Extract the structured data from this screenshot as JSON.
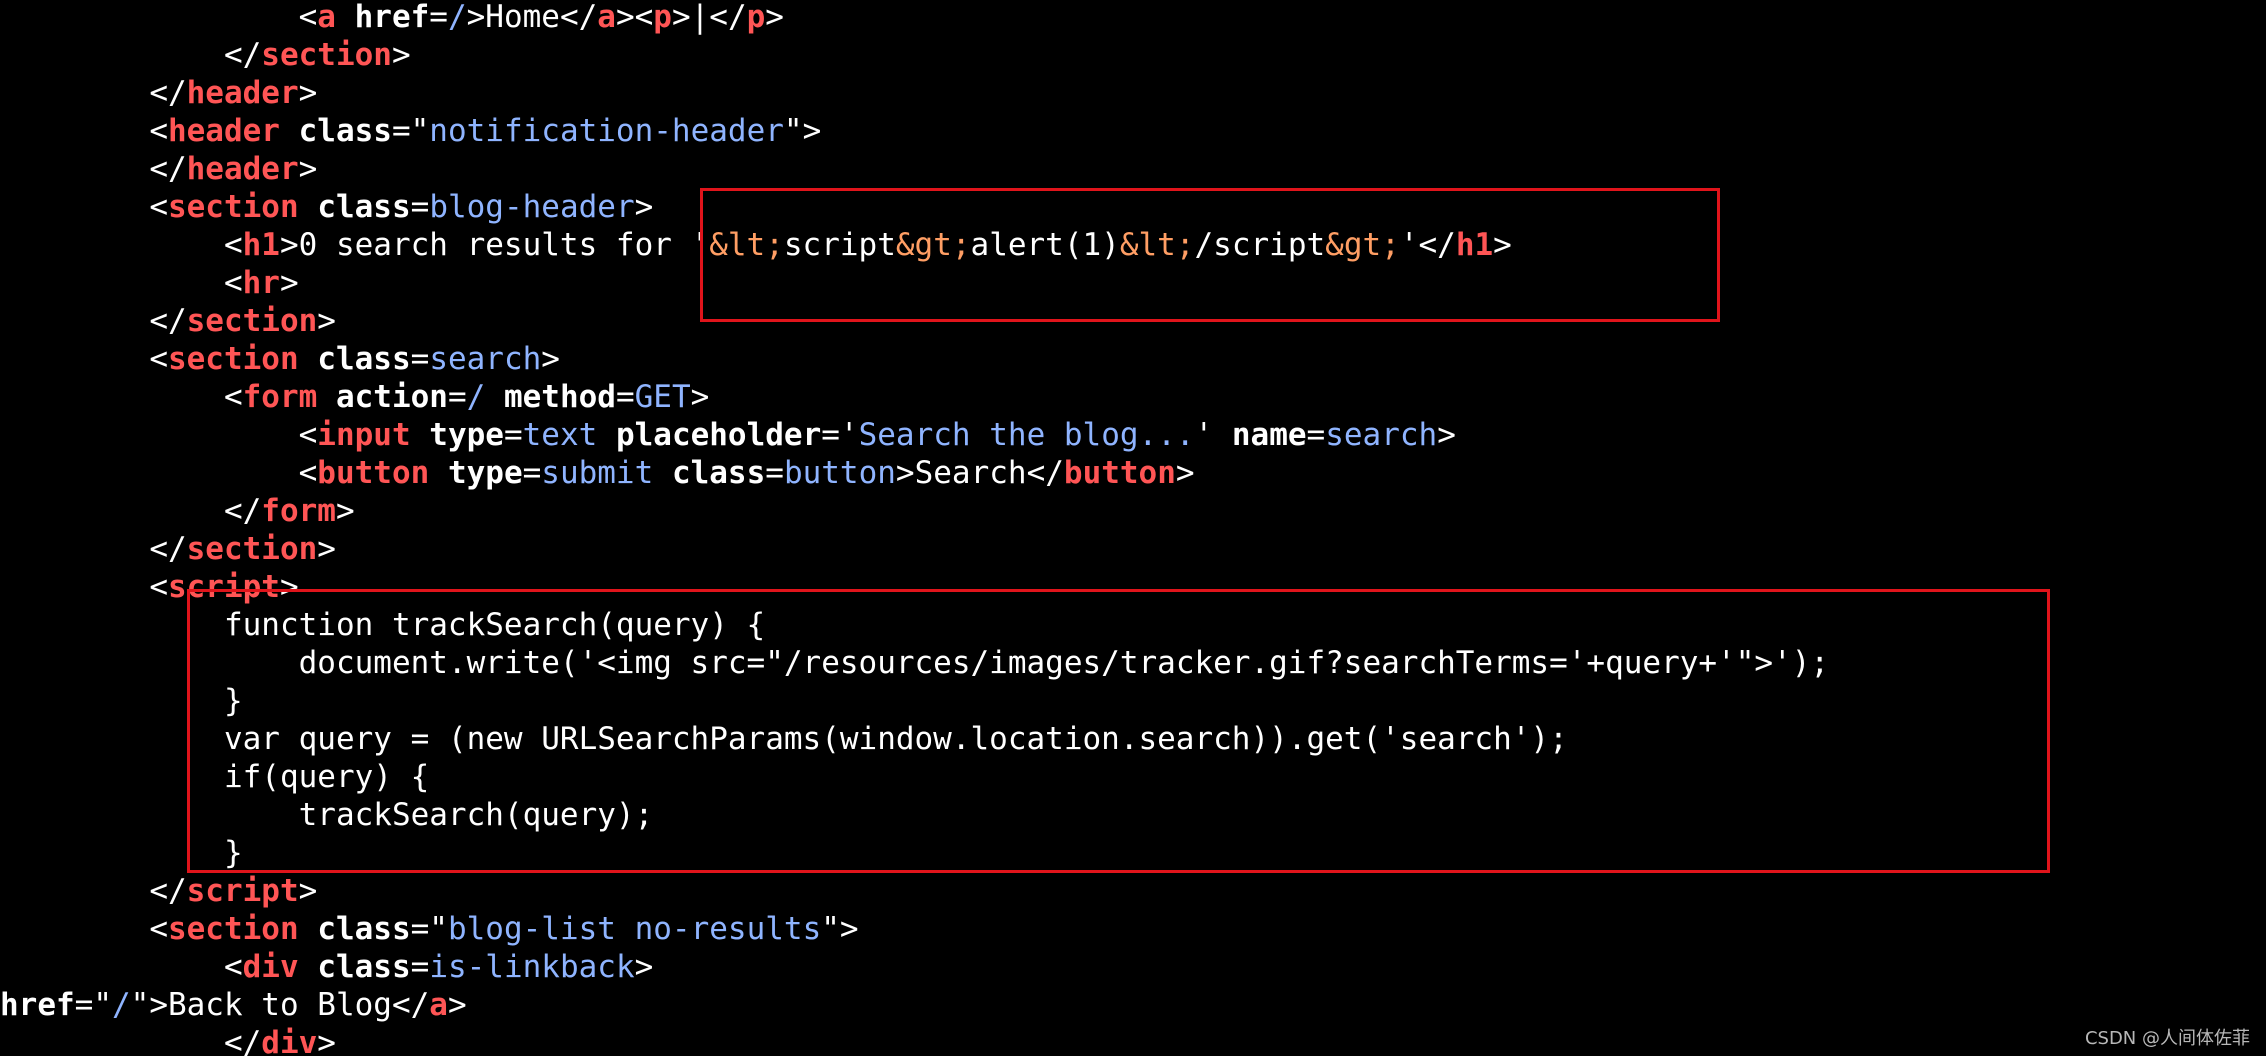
{
  "lines": [
    {
      "indent": "                ",
      "segments": [
        {
          "text": "<",
          "c": ""
        },
        {
          "text": "a",
          "c": "tag"
        },
        {
          "text": " ",
          "c": ""
        },
        {
          "text": "href",
          "c": "attr"
        },
        {
          "text": "=",
          "c": ""
        },
        {
          "text": "/",
          "c": "val"
        },
        {
          "text": ">Home</",
          "c": ""
        },
        {
          "text": "a",
          "c": "tag"
        },
        {
          "text": "><",
          "c": ""
        },
        {
          "text": "p",
          "c": "tag"
        },
        {
          "text": ">|</",
          "c": ""
        },
        {
          "text": "p",
          "c": "tag"
        },
        {
          "text": ">",
          "c": ""
        }
      ]
    },
    {
      "indent": "            ",
      "segments": [
        {
          "text": "</",
          "c": ""
        },
        {
          "text": "section",
          "c": "tag"
        },
        {
          "text": ">",
          "c": ""
        }
      ]
    },
    {
      "indent": "        ",
      "segments": [
        {
          "text": "</",
          "c": ""
        },
        {
          "text": "header",
          "c": "tag"
        },
        {
          "text": ">",
          "c": ""
        }
      ]
    },
    {
      "indent": "        ",
      "segments": [
        {
          "text": "<",
          "c": ""
        },
        {
          "text": "header",
          "c": "tag"
        },
        {
          "text": " ",
          "c": ""
        },
        {
          "text": "class",
          "c": "attr"
        },
        {
          "text": "=\"",
          "c": ""
        },
        {
          "text": "notification-header",
          "c": "val"
        },
        {
          "text": "\">",
          "c": ""
        }
      ]
    },
    {
      "indent": "        ",
      "segments": [
        {
          "text": "</",
          "c": ""
        },
        {
          "text": "header",
          "c": "tag"
        },
        {
          "text": ">",
          "c": ""
        }
      ]
    },
    {
      "indent": "        ",
      "segments": [
        {
          "text": "<",
          "c": ""
        },
        {
          "text": "section",
          "c": "tag"
        },
        {
          "text": " ",
          "c": ""
        },
        {
          "text": "class",
          "c": "attr"
        },
        {
          "text": "=",
          "c": ""
        },
        {
          "text": "blog-header",
          "c": "val"
        },
        {
          "text": ">",
          "c": ""
        }
      ]
    },
    {
      "indent": "            ",
      "segments": [
        {
          "text": "<",
          "c": ""
        },
        {
          "text": "h1",
          "c": "tag"
        },
        {
          "text": ">0 search results for '",
          "c": ""
        },
        {
          "text": "&lt;",
          "c": "ent"
        },
        {
          "text": "script",
          "c": ""
        },
        {
          "text": "&gt;",
          "c": "ent"
        },
        {
          "text": "alert(1)",
          "c": ""
        },
        {
          "text": "&lt;",
          "c": "ent"
        },
        {
          "text": "/script",
          "c": ""
        },
        {
          "text": "&gt;",
          "c": "ent"
        },
        {
          "text": "'</",
          "c": ""
        },
        {
          "text": "h1",
          "c": "tag"
        },
        {
          "text": ">",
          "c": ""
        }
      ]
    },
    {
      "indent": "            ",
      "segments": [
        {
          "text": "<",
          "c": ""
        },
        {
          "text": "hr",
          "c": "tag"
        },
        {
          "text": ">",
          "c": ""
        }
      ]
    },
    {
      "indent": "        ",
      "segments": [
        {
          "text": "</",
          "c": ""
        },
        {
          "text": "section",
          "c": "tag"
        },
        {
          "text": ">",
          "c": ""
        }
      ]
    },
    {
      "indent": "        ",
      "segments": [
        {
          "text": "<",
          "c": ""
        },
        {
          "text": "section",
          "c": "tag"
        },
        {
          "text": " ",
          "c": ""
        },
        {
          "text": "class",
          "c": "attr"
        },
        {
          "text": "=",
          "c": ""
        },
        {
          "text": "search",
          "c": "val"
        },
        {
          "text": ">",
          "c": ""
        }
      ]
    },
    {
      "indent": "            ",
      "segments": [
        {
          "text": "<",
          "c": ""
        },
        {
          "text": "form",
          "c": "tag"
        },
        {
          "text": " ",
          "c": ""
        },
        {
          "text": "action",
          "c": "attr"
        },
        {
          "text": "=",
          "c": ""
        },
        {
          "text": "/",
          "c": "val"
        },
        {
          "text": " ",
          "c": ""
        },
        {
          "text": "method",
          "c": "attr"
        },
        {
          "text": "=",
          "c": ""
        },
        {
          "text": "GET",
          "c": "val"
        },
        {
          "text": ">",
          "c": ""
        }
      ]
    },
    {
      "indent": "                ",
      "segments": [
        {
          "text": "<",
          "c": ""
        },
        {
          "text": "input",
          "c": "tag"
        },
        {
          "text": " ",
          "c": ""
        },
        {
          "text": "type",
          "c": "attr"
        },
        {
          "text": "=",
          "c": ""
        },
        {
          "text": "text",
          "c": "val"
        },
        {
          "text": " ",
          "c": ""
        },
        {
          "text": "placeholder",
          "c": "attr"
        },
        {
          "text": "='",
          "c": ""
        },
        {
          "text": "Search the blog...",
          "c": "val"
        },
        {
          "text": "' ",
          "c": ""
        },
        {
          "text": "name",
          "c": "attr"
        },
        {
          "text": "=",
          "c": ""
        },
        {
          "text": "search",
          "c": "val"
        },
        {
          "text": ">",
          "c": ""
        }
      ]
    },
    {
      "indent": "                ",
      "segments": [
        {
          "text": "<",
          "c": ""
        },
        {
          "text": "button",
          "c": "tag"
        },
        {
          "text": " ",
          "c": ""
        },
        {
          "text": "type",
          "c": "attr"
        },
        {
          "text": "=",
          "c": ""
        },
        {
          "text": "submit",
          "c": "val"
        },
        {
          "text": " ",
          "c": ""
        },
        {
          "text": "class",
          "c": "attr"
        },
        {
          "text": "=",
          "c": ""
        },
        {
          "text": "button",
          "c": "val"
        },
        {
          "text": ">Search</",
          "c": ""
        },
        {
          "text": "button",
          "c": "tag"
        },
        {
          "text": ">",
          "c": ""
        }
      ]
    },
    {
      "indent": "            ",
      "segments": [
        {
          "text": "</",
          "c": ""
        },
        {
          "text": "form",
          "c": "tag"
        },
        {
          "text": ">",
          "c": ""
        }
      ]
    },
    {
      "indent": "        ",
      "segments": [
        {
          "text": "</",
          "c": ""
        },
        {
          "text": "section",
          "c": "tag"
        },
        {
          "text": ">",
          "c": ""
        }
      ]
    },
    {
      "indent": "        ",
      "segments": [
        {
          "text": "<",
          "c": ""
        },
        {
          "text": "script",
          "c": "tag"
        },
        {
          "text": ">",
          "c": ""
        }
      ]
    },
    {
      "indent": "            ",
      "segments": [
        {
          "text": "function trackSearch(query) {",
          "c": ""
        }
      ]
    },
    {
      "indent": "                ",
      "segments": [
        {
          "text": "document.write('<img src=\"/resources/images/tracker.gif?searchTerms='+query+'\">');",
          "c": ""
        }
      ]
    },
    {
      "indent": "            ",
      "segments": [
        {
          "text": "}",
          "c": ""
        }
      ]
    },
    {
      "indent": "            ",
      "segments": [
        {
          "text": "var query = (new URLSearchParams(window.location.search)).get('search');",
          "c": ""
        }
      ]
    },
    {
      "indent": "            ",
      "segments": [
        {
          "text": "if(query) {",
          "c": ""
        }
      ]
    },
    {
      "indent": "                ",
      "segments": [
        {
          "text": "trackSearch(query);",
          "c": ""
        }
      ]
    },
    {
      "indent": "            ",
      "segments": [
        {
          "text": "}",
          "c": ""
        }
      ]
    },
    {
      "indent": "        ",
      "segments": [
        {
          "text": "</",
          "c": ""
        },
        {
          "text": "script",
          "c": "tag"
        },
        {
          "text": ">",
          "c": ""
        }
      ]
    },
    {
      "indent": "        ",
      "segments": [
        {
          "text": "<",
          "c": ""
        },
        {
          "text": "section",
          "c": "tag"
        },
        {
          "text": " ",
          "c": ""
        },
        {
          "text": "class",
          "c": "attr"
        },
        {
          "text": "=\"",
          "c": ""
        },
        {
          "text": "blog-list no-results",
          "c": "val"
        },
        {
          "text": "\">",
          "c": ""
        }
      ]
    },
    {
      "indent": "            ",
      "segments": [
        {
          "text": "<",
          "c": ""
        },
        {
          "text": "div",
          "c": "tag"
        },
        {
          "text": " ",
          "c": ""
        },
        {
          "text": "class",
          "c": "attr"
        },
        {
          "text": "=",
          "c": ""
        },
        {
          "text": "is-linkback",
          "c": "val"
        },
        {
          "text": ">",
          "c": ""
        }
      ]
    },
    {
      "indent": "",
      "segments": [
        {
          "text": "href",
          "c": "attr"
        },
        {
          "text": "=\"",
          "c": ""
        },
        {
          "text": "/",
          "c": "val"
        },
        {
          "text": "\">Back to Blog</",
          "c": ""
        },
        {
          "text": "a",
          "c": "tag"
        },
        {
          "text": ">",
          "c": ""
        }
      ]
    },
    {
      "indent": "            ",
      "segments": [
        {
          "text": "</",
          "c": ""
        },
        {
          "text": "div",
          "c": "tag"
        },
        {
          "text": ">",
          "c": ""
        }
      ]
    }
  ],
  "highlights": [
    {
      "name": "highlight-box-h1"
    },
    {
      "name": "highlight-box-script"
    }
  ],
  "watermark": "CSDN @人间体佐菲",
  "colors": {
    "background": "#000000",
    "tag": "#ff5555",
    "attribute_value": "#8fb4ff",
    "entity": "#ff9e64",
    "highlight_border": "#e0141b"
  }
}
